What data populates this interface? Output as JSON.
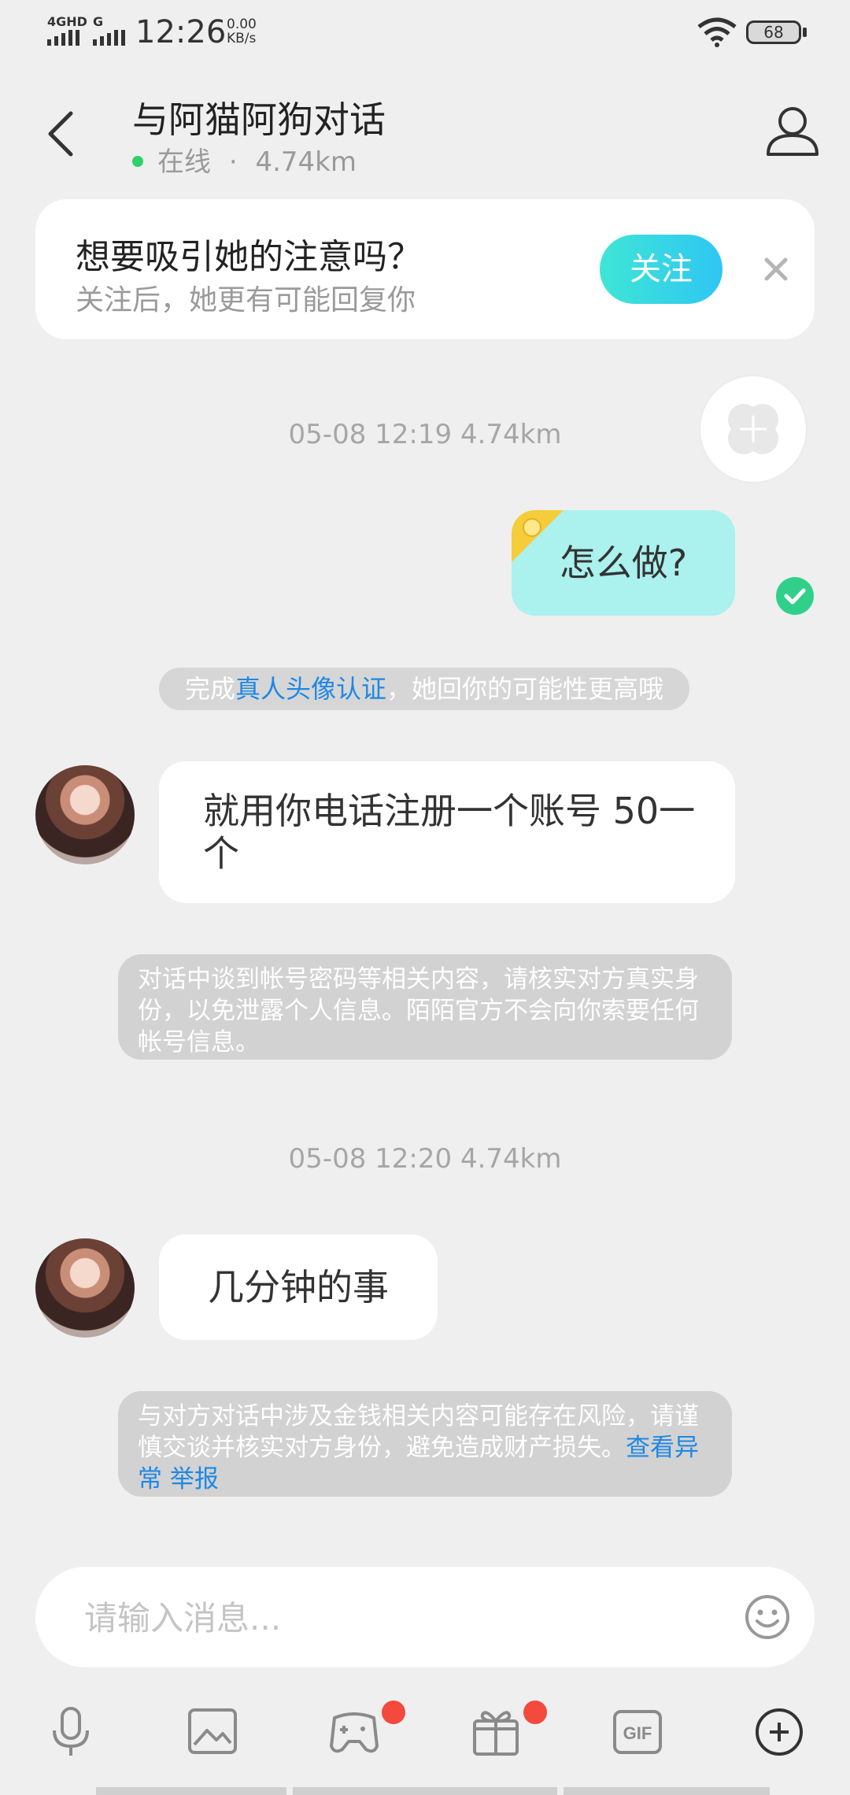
{
  "status_bar": {
    "signal_1": "4GHD",
    "signal_2": "G",
    "time": "12:26",
    "net_speed_value": "0.00",
    "net_speed_unit": "KB/s",
    "battery": "68"
  },
  "header": {
    "title": "与阿猫阿狗对话",
    "status": "在线",
    "separator": "·",
    "distance": "4.74km"
  },
  "follow_card": {
    "title": "想要吸引她的注意吗？",
    "subtitle": "关注后，她更有可能回复你",
    "button_label": "关注"
  },
  "messages": {
    "timestamp_1": "05-08 12:19  4.74km",
    "my_message": "怎么做?",
    "verify_prefix": "完成",
    "verify_link": "真人头像认证",
    "verify_suffix": "，她回你的可能性更高哦",
    "their_message_1": "就用你电话注册一个账号 50一个",
    "warning_1": "对话中谈到帐号密码等相关内容，请核实对方真实身份，以免泄露个人信息。陌陌官方不会向你索要任何帐号信息。",
    "timestamp_2": "05-08 12:20  4.74km",
    "their_message_2": "几分钟的事",
    "warning_2_text": "与对方对话中涉及金钱相关内容可能存在风险，请谨慎交谈并核实对方身份，避免造成财产损失。",
    "warning_2_link_1": "查看异常",
    "warning_2_link_2": "举报"
  },
  "input": {
    "placeholder": "请输入消息..."
  },
  "toolbar": {
    "gif_label": "GIF"
  }
}
